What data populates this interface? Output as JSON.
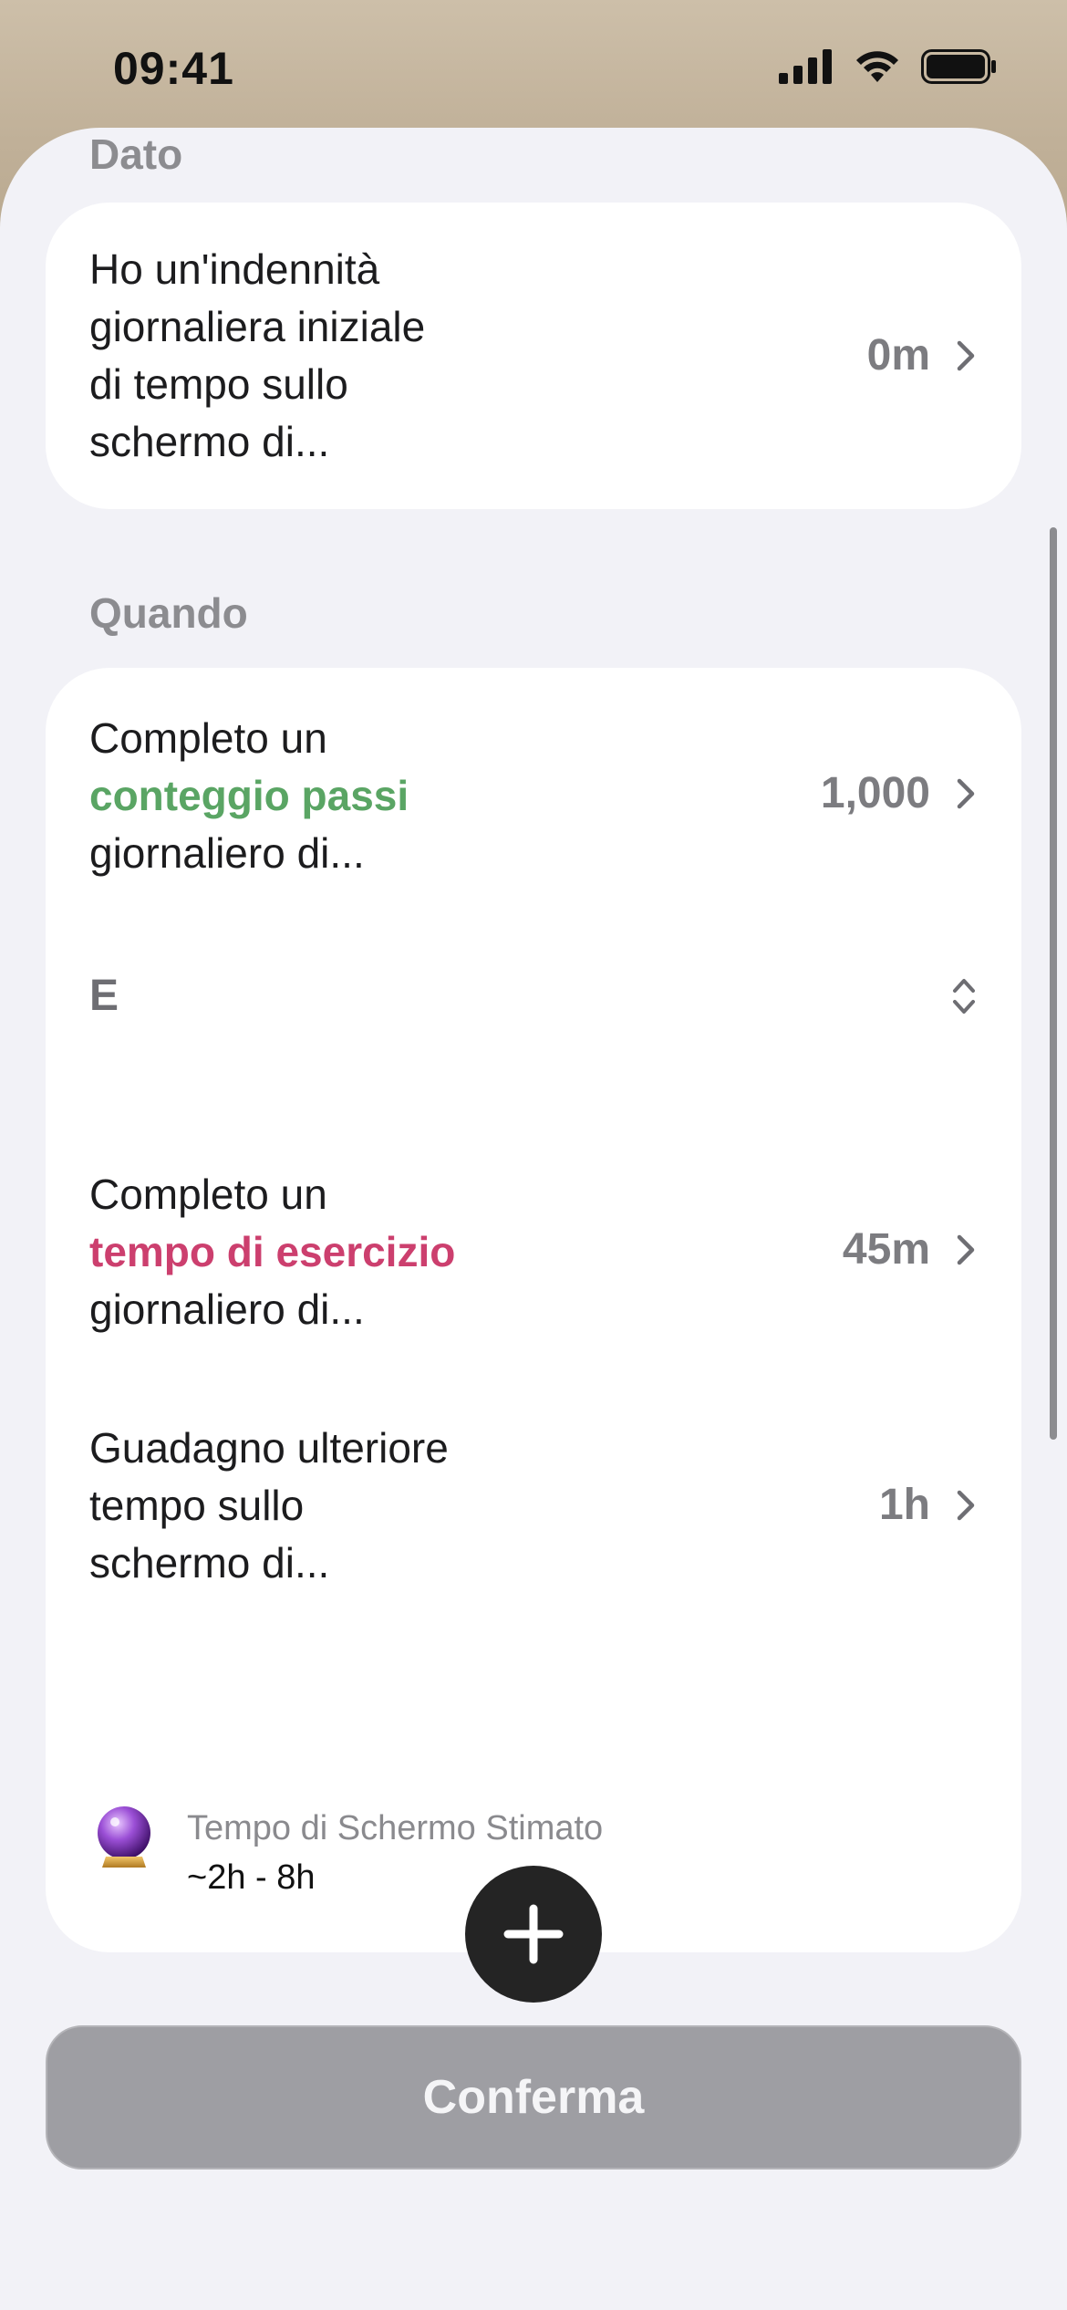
{
  "status_bar": {
    "time": "09:41"
  },
  "given": {
    "section_label": "Dato",
    "row": {
      "text_lines": [
        "Ho un'indennità",
        "giornaliera iniziale",
        "di tempo sullo",
        "schermo di..."
      ],
      "value": "0m"
    }
  },
  "when": {
    "section_label": "Quando",
    "steps_row": {
      "line1": "Completo un",
      "highlight": "conteggio passi",
      "line3": "giornaliero di...",
      "value": "1,000"
    },
    "operator": "E",
    "exercise_row": {
      "line1": "Completo un",
      "highlight": "tempo di esercizio",
      "line3": "giornaliero di...",
      "value": "45m"
    },
    "earn_row": {
      "text_lines": [
        "Guadagno ulteriore",
        "tempo sullo",
        "schermo di..."
      ],
      "value": "1h"
    },
    "estimate": {
      "icon": "crystal-ball-icon",
      "title": "Tempo di Schermo Stimato",
      "value": "~2h - 8h"
    }
  },
  "add_button": {
    "icon": "plus-icon"
  },
  "confirm_button": {
    "label": "Conferma"
  },
  "colors": {
    "green_highlight": "#5aa564",
    "pink_highlight": "#cc3f6e",
    "confirm_disabled": "#9e9ea3"
  }
}
